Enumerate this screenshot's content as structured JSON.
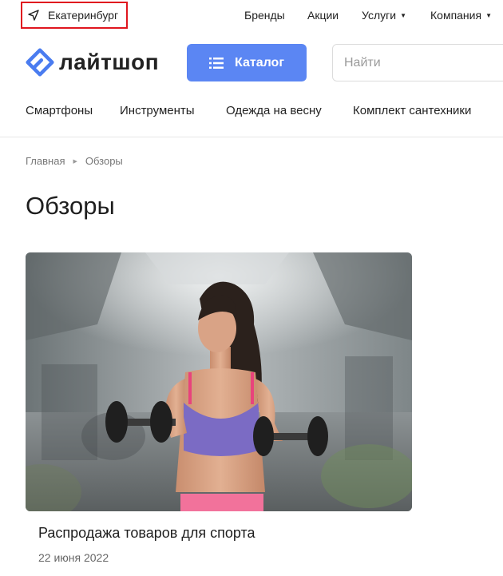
{
  "topbar": {
    "city": "Екатеринбург",
    "links": {
      "brands": "Бренды",
      "promotions": "Акции",
      "services": "Услуги",
      "company": "Компания"
    }
  },
  "header": {
    "logo_text": "лайтшоп",
    "catalog_label": "Каталог",
    "search_placeholder": "Найти"
  },
  "categories": [
    "Смартфоны",
    "Инструменты",
    "Одежда на весну",
    "Комплект сантехники"
  ],
  "breadcrumb": {
    "home": "Главная",
    "current": "Обзоры"
  },
  "page": {
    "title": "Обзоры"
  },
  "articles": [
    {
      "title": "Распродажа товаров для спорта",
      "date": "22 июня 2022"
    }
  ],
  "colors": {
    "accent": "#5b86f3",
    "highlight_border": "#e0161f"
  }
}
